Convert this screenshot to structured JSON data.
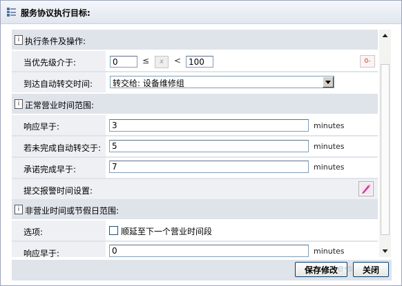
{
  "window": {
    "title": "服务协议执行目标:"
  },
  "sections": {
    "conditions": {
      "box": "i",
      "title": "执行条件及操作:"
    },
    "business_hours": {
      "box": "i",
      "title": "正常营业时间范围:"
    },
    "non_business": {
      "box": "i",
      "title": "非营业时间或节假日范围:"
    }
  },
  "conditions": {
    "priority": {
      "label": "当优先级介于:",
      "min": "0",
      "leq": "≤",
      "x": "x",
      "lt": "<",
      "max": "100",
      "badge": "0-"
    },
    "auto_transfer": {
      "label": "到达自动转交时间:",
      "value": "转交给: 设备维修组"
    }
  },
  "business_hours": {
    "respond": {
      "label": "响应早于:",
      "value": "3",
      "unit": "minutes"
    },
    "unfinished_transfer": {
      "label": "若未完成自动转交于:",
      "value": "5",
      "unit": "minutes"
    },
    "promise_complete": {
      "label": "承诺完成早于:",
      "value": "7",
      "unit": "minutes"
    },
    "alert_settings": {
      "label": "提交报警时间设置:"
    }
  },
  "non_business": {
    "options": {
      "label": "选项:",
      "checkbox_label": "顺延至下一个营业时间段",
      "checked": false
    },
    "respond": {
      "label": "响应早于:",
      "value": "0",
      "unit": "minutes"
    }
  },
  "buttons": {
    "save": "保存修改",
    "close": "关闭"
  },
  "colors": {
    "section_bg": "#dfe3ea",
    "label_bg": "#eef0f4",
    "border": "#7f9db9",
    "accent_red": "#c0392b"
  }
}
